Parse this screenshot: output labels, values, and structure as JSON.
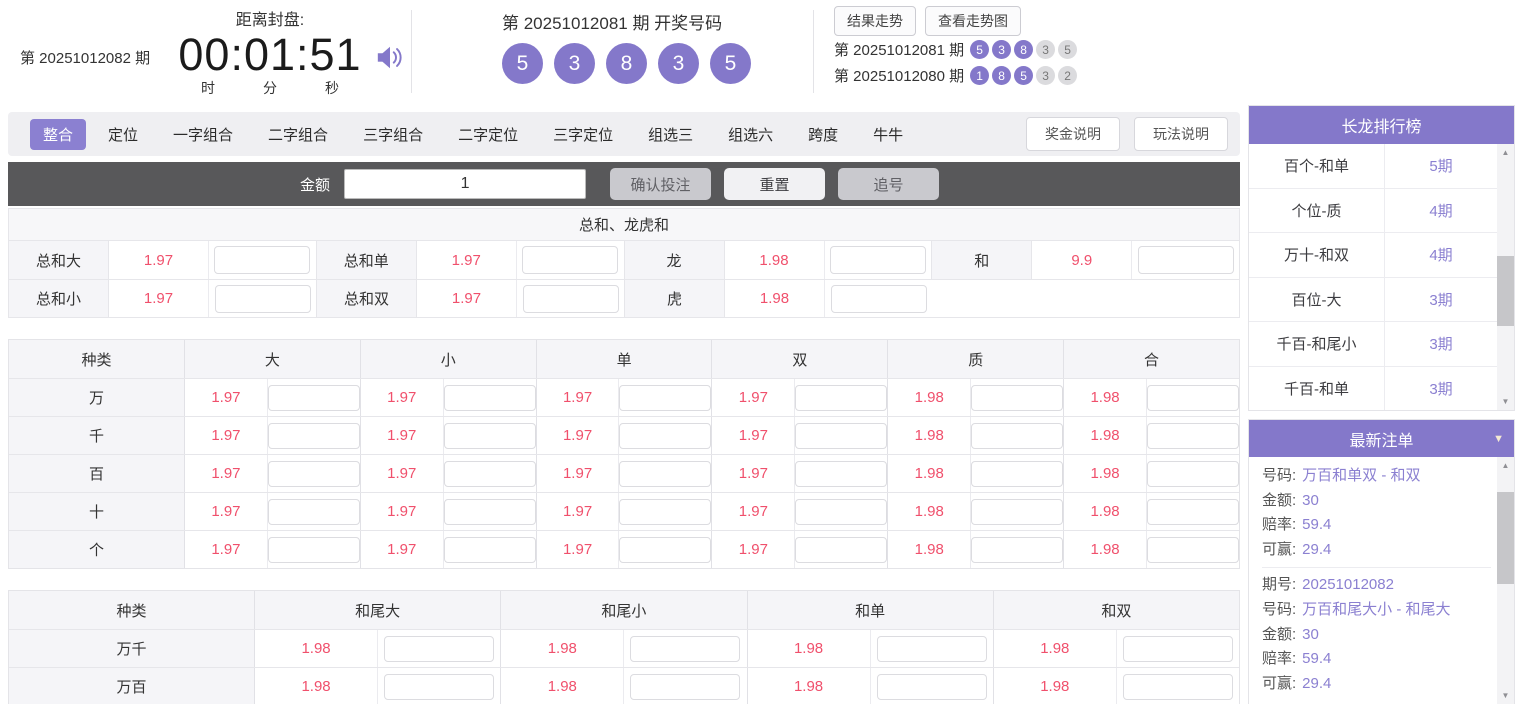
{
  "colors": {
    "accent_purple": "#8478ca",
    "odds_red": "#f0506c",
    "bar_gray": "#58585a",
    "value_purple": "#8b80d1"
  },
  "icons": {
    "scroll_up": "▲",
    "scroll_down": "▼",
    "collapse": "▼"
  },
  "header": {
    "issue_label": "第 20251012082 期",
    "close_label": "距离封盘:",
    "countdown": "00:01:51",
    "units": [
      "时",
      "分",
      "秒"
    ],
    "draw_title": "第 20251012081 期  开奖号码",
    "draw_balls": [
      "5",
      "3",
      "8",
      "3",
      "5"
    ],
    "trend_buttons": [
      "结果走势",
      "查看走势图"
    ],
    "history": [
      {
        "issue": "第 20251012081 期",
        "balls": [
          {
            "n": "5",
            "hl": true
          },
          {
            "n": "3",
            "hl": true
          },
          {
            "n": "8",
            "hl": true
          },
          {
            "n": "3",
            "hl": false
          },
          {
            "n": "5",
            "hl": false
          }
        ]
      },
      {
        "issue": "第 20251012080 期",
        "balls": [
          {
            "n": "1",
            "hl": true
          },
          {
            "n": "8",
            "hl": true
          },
          {
            "n": "5",
            "hl": true
          },
          {
            "n": "3",
            "hl": false
          },
          {
            "n": "2",
            "hl": false
          }
        ]
      }
    ]
  },
  "tabs": {
    "items": [
      {
        "label": "整合",
        "active": true
      },
      {
        "label": "定位",
        "active": false
      },
      {
        "label": "一字组合",
        "active": false
      },
      {
        "label": "二字组合",
        "active": false
      },
      {
        "label": "三字组合",
        "active": false
      },
      {
        "label": "二字定位",
        "active": false
      },
      {
        "label": "三字定位",
        "active": false
      },
      {
        "label": "组选三",
        "active": false
      },
      {
        "label": "组选六",
        "active": false
      },
      {
        "label": "跨度",
        "active": false
      },
      {
        "label": "牛牛",
        "active": false
      }
    ],
    "info_buttons": [
      "奖金说明",
      "玩法说明"
    ]
  },
  "bet_bar": {
    "amount_label": "金额",
    "amount_value": "1",
    "buttons": [
      "确认投注",
      "重置",
      "追号"
    ]
  },
  "sum_section": {
    "title": "总和、龙虎和",
    "rows": [
      {
        "groups": [
          {
            "label": "总和大",
            "odds": "1.97",
            "blank": false
          },
          {
            "label": "总和单",
            "odds": "1.97",
            "blank": false
          },
          {
            "label": "龙",
            "odds": "1.98",
            "blank": false
          },
          {
            "label": "和",
            "odds": "9.9",
            "blank": false
          }
        ]
      },
      {
        "groups": [
          {
            "label": "总和小",
            "odds": "1.97",
            "blank": false
          },
          {
            "label": "总和双",
            "odds": "1.97",
            "blank": false
          },
          {
            "label": "虎",
            "odds": "1.98",
            "blank": false
          },
          {
            "blank": true
          }
        ]
      }
    ]
  },
  "position_table": {
    "label_header": "种类",
    "col_headers": [
      "大",
      "小",
      "单",
      "双",
      "质",
      "合"
    ],
    "rows": [
      {
        "label": "万",
        "odds": [
          "1.97",
          "1.97",
          "1.97",
          "1.97",
          "1.98",
          "1.98"
        ]
      },
      {
        "label": "千",
        "odds": [
          "1.97",
          "1.97",
          "1.97",
          "1.97",
          "1.98",
          "1.98"
        ]
      },
      {
        "label": "百",
        "odds": [
          "1.97",
          "1.97",
          "1.97",
          "1.97",
          "1.98",
          "1.98"
        ]
      },
      {
        "label": "十",
        "odds": [
          "1.97",
          "1.97",
          "1.97",
          "1.97",
          "1.98",
          "1.98"
        ]
      },
      {
        "label": "个",
        "odds": [
          "1.97",
          "1.97",
          "1.97",
          "1.97",
          "1.98",
          "1.98"
        ]
      }
    ]
  },
  "tail_table": {
    "label_header": "种类",
    "col_headers": [
      "和尾大",
      "和尾小",
      "和单",
      "和双"
    ],
    "rows": [
      {
        "label": "万千",
        "odds": [
          "1.98",
          "1.98",
          "1.98",
          "1.98"
        ]
      },
      {
        "label": "万百",
        "odds": [
          "1.98",
          "1.98",
          "1.98",
          "1.98"
        ]
      }
    ]
  },
  "dragon_panel": {
    "title": "长龙排行榜",
    "rows": [
      {
        "name": "百个-和单",
        "count": "5期"
      },
      {
        "name": "个位-质",
        "count": "4期"
      },
      {
        "name": "万十-和双",
        "count": "4期"
      },
      {
        "name": "百位-大",
        "count": "3期"
      },
      {
        "name": "千百-和尾小",
        "count": "3期"
      },
      {
        "name": "千百-和单",
        "count": "3期"
      }
    ]
  },
  "orders_panel": {
    "title": "最新注单",
    "entries": [
      {
        "fields": [
          {
            "label": "号码:",
            "value": "万百和单双 - 和双"
          },
          {
            "label": "金额:",
            "value": "30"
          },
          {
            "label": "赔率:",
            "value": "59.4"
          },
          {
            "label": "可赢:",
            "value": "29.4"
          }
        ]
      },
      {
        "fields": [
          {
            "label": "期号:",
            "value": "20251012082"
          },
          {
            "label": "号码:",
            "value": "万百和尾大小 - 和尾大"
          },
          {
            "label": "金额:",
            "value": "30"
          },
          {
            "label": "赔率:",
            "value": "59.4"
          },
          {
            "label": "可赢:",
            "value": "29.4"
          }
        ]
      }
    ]
  }
}
